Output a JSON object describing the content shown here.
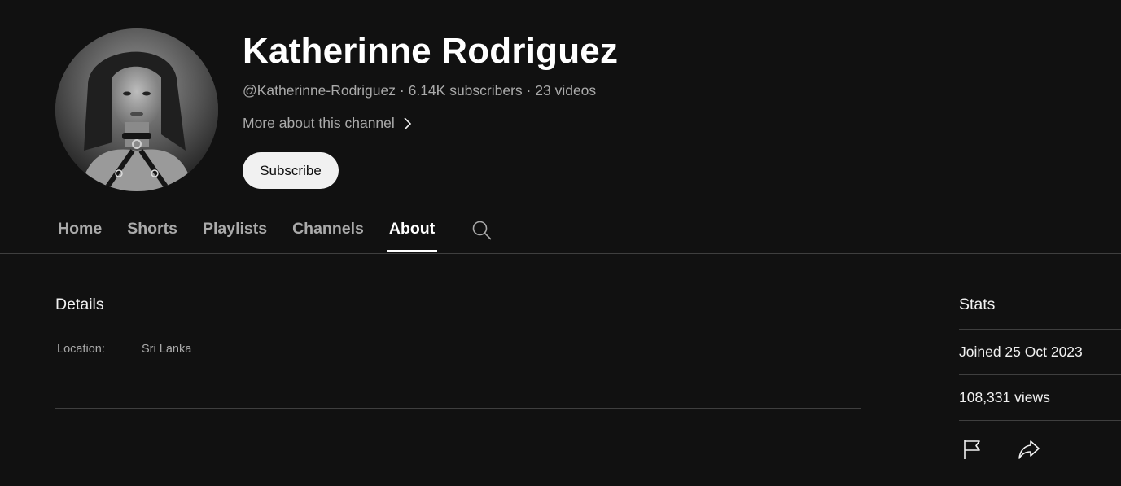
{
  "channel": {
    "name": "Katherinne Rodriguez",
    "handle": "@Katherinne-Rodriguez",
    "separator": "·",
    "subscribers": "6.14K subscribers",
    "videos": "23 videos",
    "more_about": "More about this channel",
    "subscribe_label": "Subscribe"
  },
  "tabs": [
    {
      "label": "Home",
      "active": false
    },
    {
      "label": "Shorts",
      "active": false
    },
    {
      "label": "Playlists",
      "active": false
    },
    {
      "label": "Channels",
      "active": false
    },
    {
      "label": "About",
      "active": true
    }
  ],
  "tab_search_icon": "search-icon",
  "details": {
    "title": "Details",
    "location_label": "Location:",
    "location_value": "Sri Lanka"
  },
  "stats": {
    "title": "Stats",
    "joined": "Joined 25 Oct 2023",
    "views": "108,331 views",
    "icons": [
      "flag-icon",
      "share-icon"
    ]
  },
  "colors": {
    "background": "#111111",
    "primary_text": "#f1f1f1",
    "secondary_text": "#aaaaaa",
    "divider": "#3f3f3f",
    "subscribe_bg": "#f1f1f1"
  }
}
